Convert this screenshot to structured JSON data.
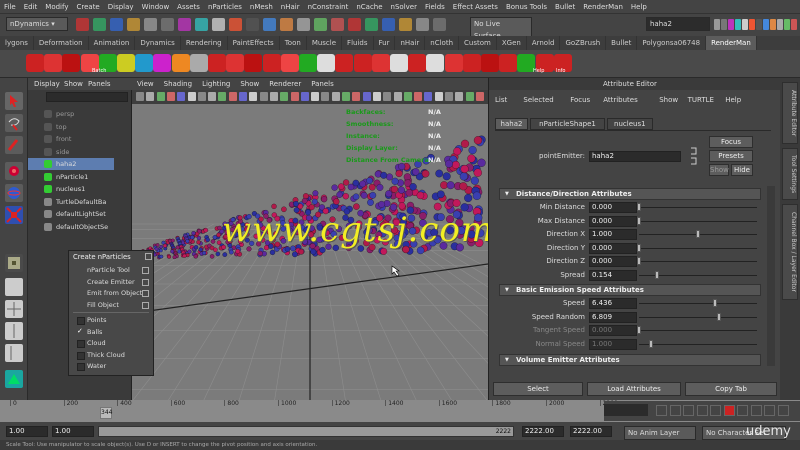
{
  "menubar": [
    "File",
    "Edit",
    "Modify",
    "Create",
    "Display",
    "Window",
    "Assets",
    "nParticles",
    "nMesh",
    "nHair",
    "nConstraint",
    "nCache",
    "nSolver",
    "Fields",
    "Effect Assets",
    "Bonus Tools",
    "Bullet",
    "RenderMan",
    "Help"
  ],
  "status": {
    "menuset": "nDynamics",
    "live_surface": "No Live Surface",
    "name_field": "haha2"
  },
  "shelf_tabs": [
    "lygons",
    "Deformation",
    "Animation",
    "Dynamics",
    "Rendering",
    "PaintEffects",
    "Toon",
    "Muscle",
    "Fluids",
    "Fur",
    "nHair",
    "nCloth",
    "Custom",
    "XGen",
    "Arnold",
    "GoZBrush",
    "Bullet",
    "Polygonsa06748",
    "RenderMan"
  ],
  "shelf_active": "RenderMan",
  "shelf_icon_labels": {
    "batch": "Batch",
    "help": "Help",
    "info": "Info"
  },
  "outliner": {
    "menu": [
      "Display",
      "Show",
      "Panels"
    ],
    "items": [
      "persp",
      "top",
      "front",
      "side",
      "haha2",
      "nParticle1",
      "nucleus1",
      "TurtleDefaultBa",
      "defaultLightSet",
      "defaultObjectSe"
    ],
    "selected": "haha2"
  },
  "viewport": {
    "menu": [
      "View",
      "Shading",
      "Lighting",
      "Show",
      "Renderer",
      "Panels"
    ],
    "hud_labels": [
      "Backfaces:",
      "Smoothness:",
      "Instance:",
      "Display Layer:",
      "Distance From Camera:"
    ],
    "hud_values": [
      "N/A",
      "N/A",
      "N/A",
      "N/A",
      "N/A"
    ]
  },
  "watermark": "www.cgtsj.com",
  "create_nparticles": {
    "title": "Create nParticles",
    "actions": [
      "nParticle Tool",
      "Create Emitter",
      "Emit from Object",
      "Fill Object"
    ],
    "types": [
      "Points",
      "Balls",
      "Cloud",
      "Thick Cloud",
      "Water"
    ],
    "selected_type": "Balls"
  },
  "attribute_editor": {
    "title": "Attribute Editor",
    "menu": [
      "List",
      "Selected",
      "Focus",
      "Attributes",
      "Show",
      "TURTLE",
      "Help"
    ],
    "tabs": [
      "haha2",
      "nParticleShape1",
      "nucleus1"
    ],
    "active_tab": "haha2",
    "point_emitter_label": "pointEmitter:",
    "point_emitter_value": "haha2",
    "focus": "Focus",
    "presets": "Presets",
    "show": "Show",
    "hide": "Hide",
    "section1": "Distance/Direction Attributes",
    "rows1": [
      {
        "label": "Min Distance",
        "value": "0.000",
        "level": 0.0
      },
      {
        "label": "Max Distance",
        "value": "0.000",
        "level": 0.0
      },
      {
        "label": "Direction X",
        "value": "1.000",
        "level": 0.5
      },
      {
        "label": "Direction Y",
        "value": "0.000",
        "level": 0.0
      },
      {
        "label": "Direction Z",
        "value": "0.000",
        "level": 0.0
      },
      {
        "label": "Spread",
        "value": "0.154",
        "level": 0.15
      }
    ],
    "section2": "Basic Emission Speed Attributes",
    "rows2": [
      {
        "label": "Speed",
        "value": "6.436",
        "level": 0.64
      },
      {
        "label": "Speed Random",
        "value": "6.809",
        "level": 0.68
      },
      {
        "label": "Tangent Speed",
        "value": "0.000",
        "level": 0.0,
        "dim": true
      },
      {
        "label": "Normal Speed",
        "value": "1.000",
        "level": 0.1,
        "dim": true
      }
    ],
    "section3": "Volume Emitter Attributes",
    "buttons": [
      "Select",
      "Load Attributes",
      "Copy Tab"
    ]
  },
  "side_tabs": [
    "Attribute Editor",
    "Tool Settings",
    "Channel Box / Layer Editor"
  ],
  "timeline": {
    "ticks": [
      "0",
      "200",
      "400",
      "600",
      "800",
      "1000",
      "1200",
      "1400",
      "1600",
      "1800",
      "2000",
      "2200"
    ],
    "current": "344"
  },
  "range": {
    "start": "1.00",
    "start2": "1.00",
    "end_slider": "2222",
    "end": "2222.00",
    "end2": "2222.00",
    "anim_layer": "No Anim Layer",
    "char_set": "No Character Set"
  },
  "helpline": "Scale Tool: Use manipulator to scale object(s). Use D or INSERT to change the pivot position and axis orientation.",
  "brand": "udemy"
}
